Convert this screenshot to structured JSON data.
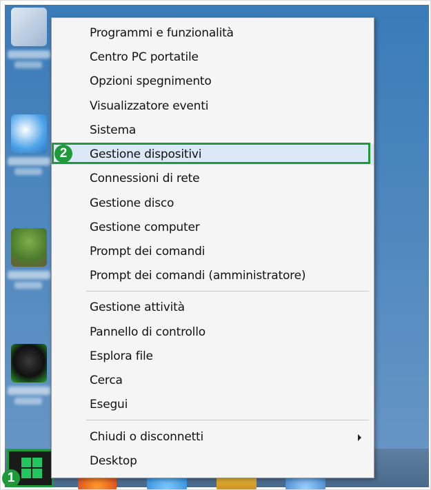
{
  "menu": {
    "group1": [
      {
        "label": "Programmi e funzionalità"
      },
      {
        "label": "Centro PC portatile"
      },
      {
        "label": "Opzioni spegnimento"
      },
      {
        "label": "Visualizzatore eventi"
      },
      {
        "label": "Sistema"
      },
      {
        "label": "Gestione dispositivi"
      },
      {
        "label": "Connessioni di rete"
      },
      {
        "label": "Gestione disco"
      },
      {
        "label": "Gestione computer"
      },
      {
        "label": "Prompt dei comandi"
      },
      {
        "label": "Prompt dei comandi (amministratore)"
      }
    ],
    "group2": [
      {
        "label": "Gestione attività"
      },
      {
        "label": "Pannello di controllo"
      },
      {
        "label": "Esplora file"
      },
      {
        "label": "Cerca"
      },
      {
        "label": "Esegui"
      }
    ],
    "group3": [
      {
        "label": "Chiudi o disconnetti"
      },
      {
        "label": "Desktop"
      }
    ],
    "highlighted": "Gestione dispositivi"
  },
  "annotations": {
    "step1": "1",
    "step2": "2"
  },
  "colors": {
    "annotation_green": "#1e9a3a",
    "start_logo": "#22c55e",
    "menu_bg": "#f5f5f5",
    "hover_bg": "#dbe8f7"
  },
  "icons": {
    "start": "windows-logo-icon",
    "submenu": "chevron-right-icon"
  }
}
